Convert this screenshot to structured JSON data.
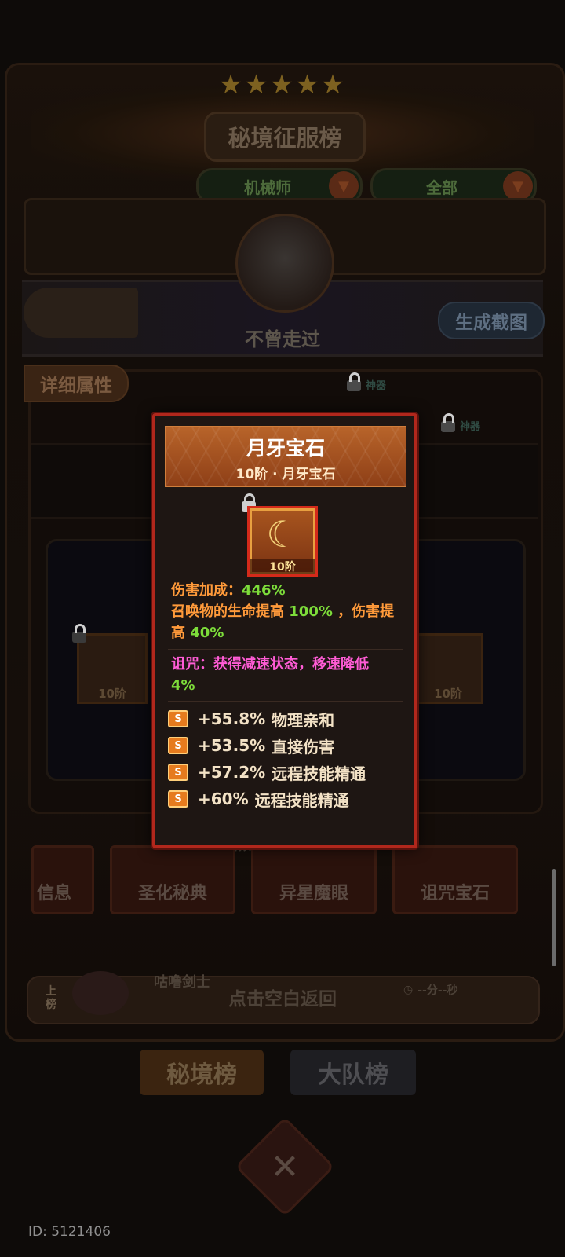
{
  "header": {
    "title": "秘境征服榜",
    "stars_glyph": "★★★★★",
    "filter_class": "机械师",
    "filter_scope": "全部",
    "dropdown_glyph": "▼"
  },
  "player": {
    "name": "不曾走过",
    "snapshot_button": "生成截图"
  },
  "detail_tab": "详细属性",
  "slots": {
    "locked_label": "神器",
    "left_level": "10阶",
    "right_level": "10阶"
  },
  "categories": [
    "信息",
    "圣化秘典",
    "异星魔眼",
    "诅咒宝石"
  ],
  "tap_to_return": "点击空白返回",
  "rank_row": {
    "label": "上榜",
    "name": "咕噜剑士",
    "time": "--分--秒"
  },
  "bottom_tabs": [
    "秘境榜",
    "大队榜"
  ],
  "close_glyph": "✕",
  "user_id": "ID: 5121406",
  "popup": {
    "title": "月牙宝石",
    "subtitle": "10阶 · 月牙宝石",
    "gem_level": "10阶",
    "gem_glyph": "☾",
    "line1_label": "伤害加成：",
    "line1_value": "446%",
    "line2_a": "召唤物的生命提高 ",
    "line2_value1": "100%",
    "line2_b": " ，伤害提高 ",
    "line2_value2": "40%",
    "curse_text": "诅咒：获得减速状态，移速降低",
    "curse_value": "4%",
    "affix_badge": "S",
    "affixes": [
      {
        "value": "+55.8%",
        "name": "物理亲和"
      },
      {
        "value": "+53.5%",
        "name": "直接伤害"
      },
      {
        "value": "+57.2%",
        "name": "远程技能精通"
      },
      {
        "value": "+60%",
        "name": "远程技能精通"
      }
    ],
    "colors": {
      "border": "#b1271c",
      "header": "#a4501f",
      "stat_label": "#ff9a3a",
      "stat_value": "#7ddc3a",
      "curse": "#ff5cd6"
    }
  }
}
